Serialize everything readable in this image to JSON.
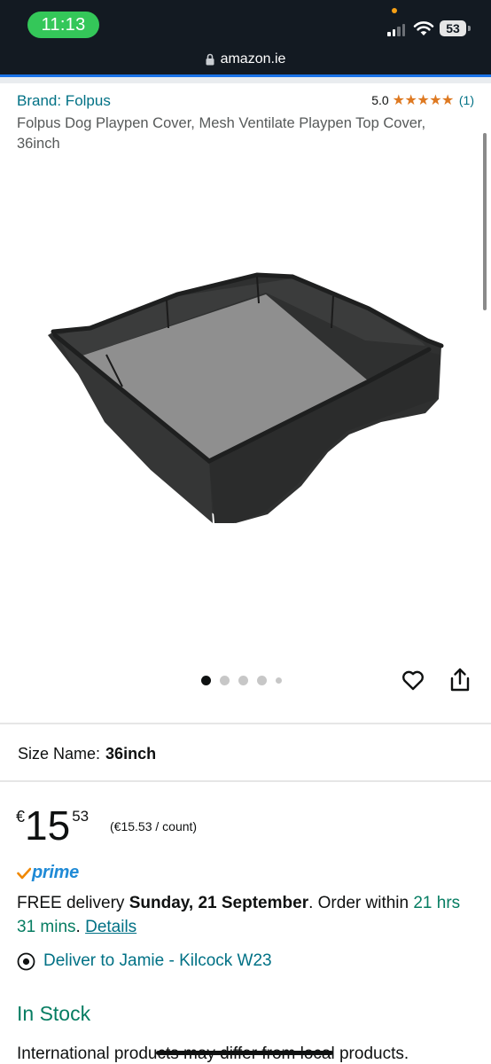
{
  "status_bar": {
    "time": "11:13",
    "battery": "53"
  },
  "browser": {
    "url": "amazon.ie"
  },
  "product": {
    "brand_link": "Brand: Folpus",
    "rating_value": "5.0",
    "stars": "★★★★★",
    "rating_count": "(1)",
    "title": "Folpus Dog Playpen Cover, Mesh Ventilate Playpen Top Cover, 36inch",
    "image_icon": "dog-playpen-cover-image"
  },
  "gallery": {
    "image_count": 5,
    "active_index": 0
  },
  "size": {
    "label": "Size Name:",
    "value": "36inch"
  },
  "price": {
    "currency": "€",
    "whole": "15",
    "fraction": "53",
    "unit_price": "(€15.53 / count)"
  },
  "prime": {
    "label": "prime"
  },
  "delivery": {
    "prefix": "FREE delivery",
    "date": "Sunday, 21 September",
    "order_within": ". Order within",
    "countdown": "21 hrs 31 mins",
    "period": ".",
    "details_link": "Details"
  },
  "deliver_to": {
    "label": "Deliver to Jamie - Kilcock W23"
  },
  "stock": {
    "status": "In Stock"
  },
  "notice": {
    "text": "International products may differ from local products."
  },
  "colors": {
    "link": "#007185",
    "green": "#067d62",
    "star": "#de7921",
    "prime_blue": "#1f8ad6",
    "header_bg": "#131a22"
  }
}
